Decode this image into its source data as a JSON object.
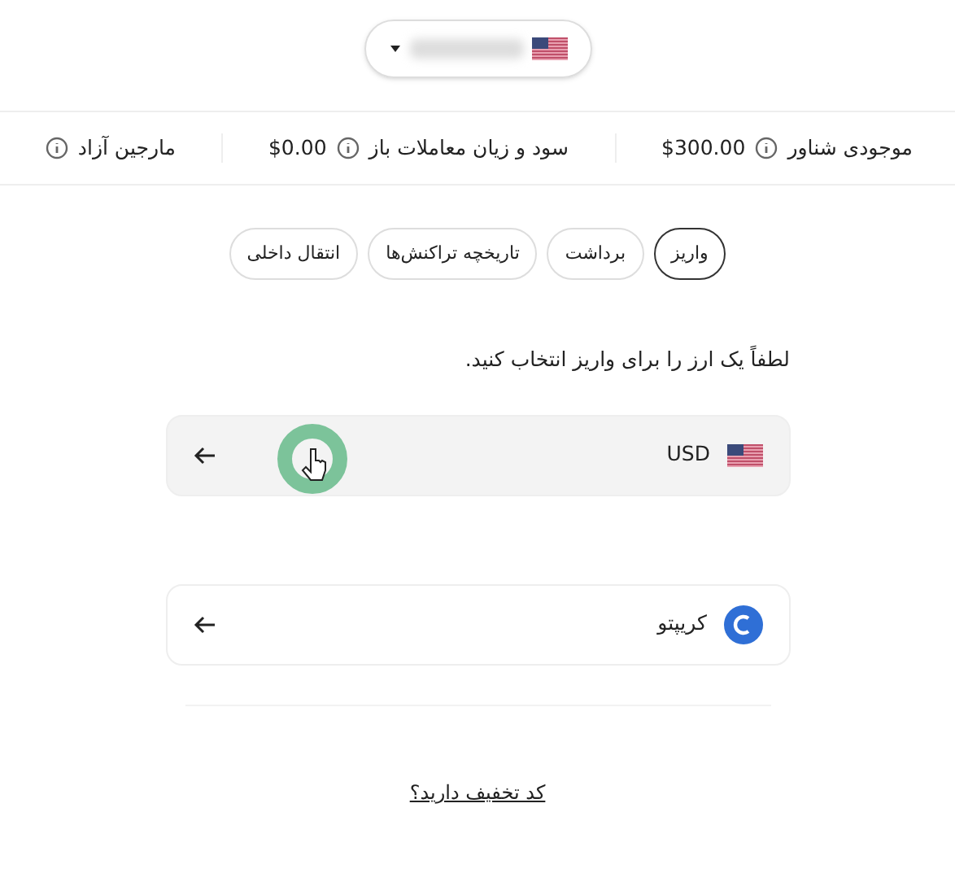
{
  "account_selector": {
    "redacted": true
  },
  "stats": [
    {
      "label": "موجودی شناور",
      "value": "$300.00"
    },
    {
      "label": "سود و زیان معاملات باز",
      "value": "$0.00"
    },
    {
      "label": "مارجین آزاد"
    }
  ],
  "tabs": [
    {
      "label": "واریز",
      "selected": true
    },
    {
      "label": "برداشت",
      "selected": false
    },
    {
      "label": "تاریخچه تراکنش‌ها",
      "selected": false
    },
    {
      "label": "انتقال داخلی",
      "selected": false
    }
  ],
  "instruction": "لطفاً یک ارز را برای واریز انتخاب کنید.",
  "options": [
    {
      "label": "USD",
      "kind": "flag",
      "hovered": true
    },
    {
      "label": "کریپتو",
      "kind": "crypto",
      "hovered": false
    }
  ],
  "promo_link": "کد تخفیف دارید؟"
}
